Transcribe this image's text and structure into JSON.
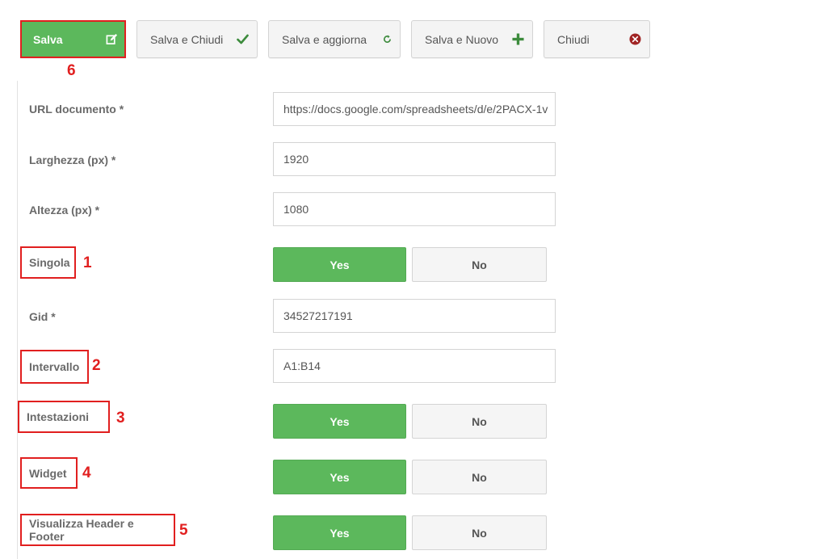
{
  "toolbar": {
    "save": {
      "label": "Salva",
      "icon": "edit-icon",
      "annotation": "6"
    },
    "save_close": {
      "label": "Salva e Chiudi",
      "icon": "check-icon"
    },
    "save_update": {
      "label": "Salva e aggiorna",
      "icon": "refresh-icon"
    },
    "save_new": {
      "label": "Salva e Nuovo",
      "icon": "plus-icon"
    },
    "close": {
      "label": "Chiudi",
      "icon": "close-circle-icon"
    }
  },
  "form": {
    "url": {
      "label": "URL documento *",
      "value": "https://docs.google.com/spreadsheets/d/e/2PACX-1v"
    },
    "width": {
      "label": "Larghezza (px) *",
      "value": "1920"
    },
    "height": {
      "label": "Altezza (px) *",
      "value": "1080"
    },
    "single": {
      "label": "Singola",
      "annotation": "1",
      "yes": "Yes",
      "no": "No",
      "selected": "Yes"
    },
    "gid": {
      "label": "Gid *",
      "value": "34527217191"
    },
    "interval": {
      "label": "Intervallo",
      "annotation": "2",
      "value": "A1:B14"
    },
    "headings": {
      "label": "Intestazioni",
      "annotation": "3",
      "yes": "Yes",
      "no": "No",
      "selected": "Yes"
    },
    "widget": {
      "label": "Widget",
      "annotation": "4",
      "yes": "Yes",
      "no": "No",
      "selected": "Yes"
    },
    "header_footer": {
      "label": "Visualizza Header e Footer",
      "annotation": "5",
      "yes": "Yes",
      "no": "No",
      "selected": "Yes"
    }
  },
  "colors": {
    "primary": "#5cb85c",
    "annotation": "#e11f1f",
    "check": "#3c8b3c",
    "close": "#a02424"
  }
}
